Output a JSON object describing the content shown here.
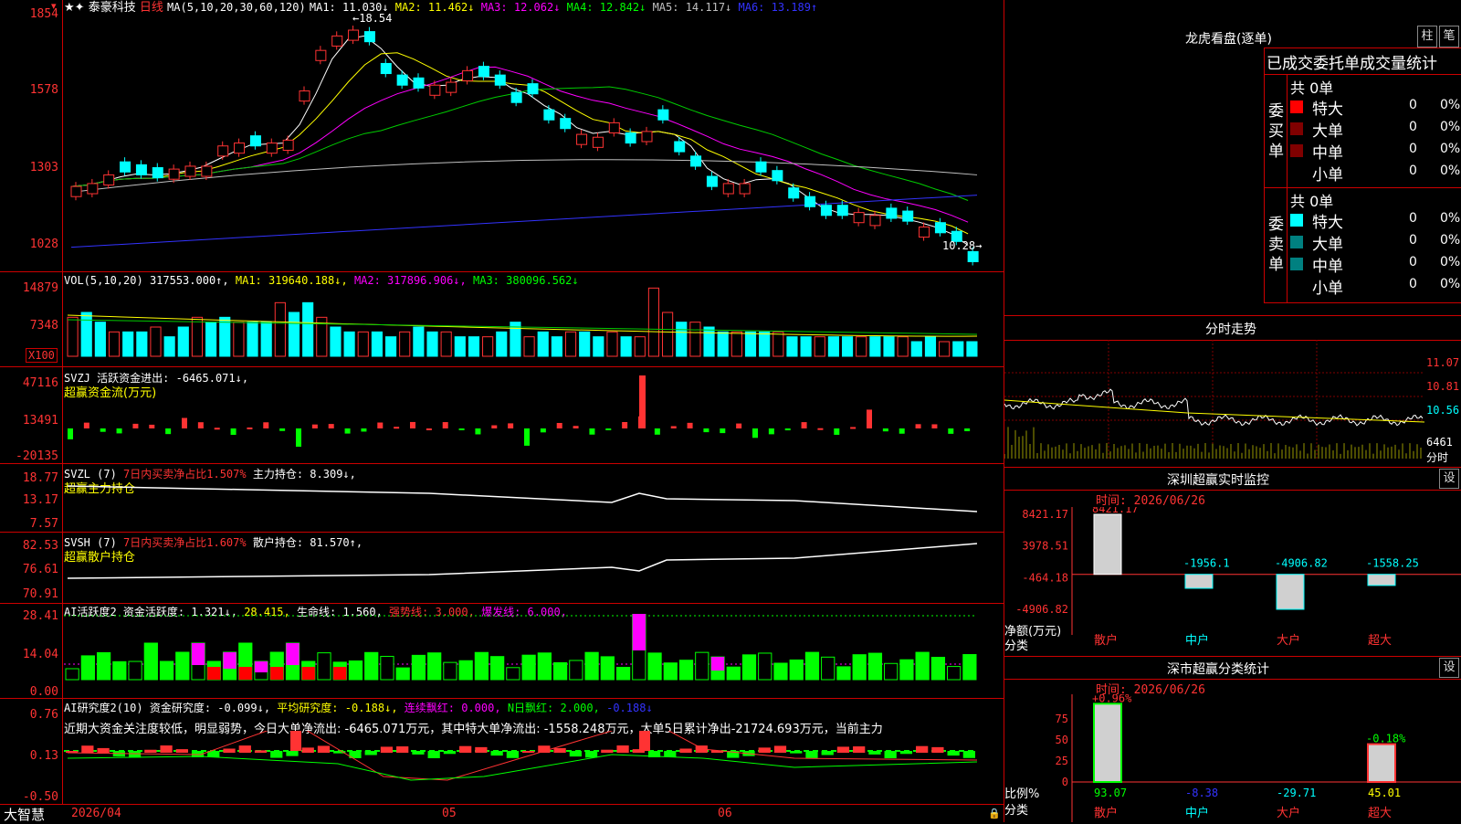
{
  "stock": {
    "name": "泰豪科技",
    "period": "日线",
    "price_high_label": "18.54",
    "price_low_label": "10.28"
  },
  "ma_bar": {
    "title": "MA(5,10,20,30,60,120)",
    "items": [
      {
        "label": "MA1: 11.030↓",
        "color": "#ffffff"
      },
      {
        "label": "MA2: 11.462↓",
        "color": "#ffff00"
      },
      {
        "label": "MA3: 12.062↓",
        "color": "#ff00ff"
      },
      {
        "label": "MA4: 12.842↓",
        "color": "#00ff00"
      },
      {
        "label": "MA5: 14.117↓",
        "color": "#c0c0c0"
      },
      {
        "label": "MA6: 13.189↑",
        "color": "#3333ff"
      }
    ]
  },
  "price_axis": [
    "1854",
    "1578",
    "1303",
    "1028"
  ],
  "vol": {
    "title": "VOL(5,10,20)",
    "value": "317553.000↑,",
    "ma1": "MA1: 319640.188↓,",
    "ma2": "MA2: 317896.906↓,",
    "ma3": "MA3: 380096.562↓",
    "axis": [
      "14879",
      "7348",
      "X100"
    ]
  },
  "svzj": {
    "title": "SVZJ",
    "text": "活跃资金进出: -6465.071↓,",
    "subtitle": "超赢资金流(万元)",
    "axis": [
      "47116",
      "13491",
      "-20135"
    ]
  },
  "svzl": {
    "title": "SVZL (7)",
    "text1": "7日内买卖净占比1.507%",
    "text2": "主力持仓: 8.309↓,",
    "subtitle": "超赢主力持仓",
    "axis": [
      "18.77",
      "13.17",
      "7.57"
    ]
  },
  "svsh": {
    "title": "SVSH (7)",
    "text1": "7日内买卖净占比1.607%",
    "text2": "散户持仓: 81.570↑,",
    "subtitle": "超赢散户持仓",
    "axis": [
      "82.53",
      "76.61",
      "70.91"
    ]
  },
  "ai1": {
    "title": "AI活跃度2",
    "text1": "资金活跃度: 1.321↓,",
    "text2": "28.415,",
    "text3": "生命线: 1.560,",
    "text4": "强势线: 3.000,",
    "text5": "爆发线: 6.000,",
    "axis": [
      "28.41",
      "14.04",
      "0.00"
    ]
  },
  "ai2": {
    "title": "AI研究度2(10)",
    "text1": "资金研究度: -0.099↓,",
    "text2": "平均研究度: -0.188↓,",
    "text3": "连续飘红: 0.000,",
    "text4": "N日飘红: 2.000,",
    "text5": "-0.188↓",
    "comment": "近期大资金关注度较低，明显弱势，今日大单净流出: -6465.071万元，其中特大单净流出: -1558.248万元，大单5日累计净出-21724.693万元，当前主力",
    "axis": [
      "0.76",
      "0.13",
      "-0.50"
    ]
  },
  "x_axis": [
    "2026/04",
    "05",
    "06"
  ],
  "brand": "大智慧",
  "right": {
    "lhb_title": "龙虎看盘(逐单)",
    "tab_zhu": "柱",
    "tab_bi": "笔",
    "stat_title": "已成交委托单成交量统计",
    "buy_label": "委买单",
    "sell_label": "委卖单",
    "buy_total": "共 0单",
    "sell_total": "共 0单",
    "rows": [
      {
        "name": "特大",
        "count": "0",
        "pct": "0%"
      },
      {
        "name": "大单",
        "count": "0",
        "pct": "0%"
      },
      {
        "name": "中单",
        "count": "0",
        "pct": "0%"
      },
      {
        "name": "小单",
        "count": "0",
        "pct": "0%"
      }
    ],
    "fs_title": "分时走势",
    "fs_axis": [
      "11.07",
      "10.81",
      "10.56",
      "6461",
      "分时"
    ],
    "monitor_title": "深圳超赢实时监控",
    "monitor_set": "设",
    "monitor_time": "时间: 2026/06/26",
    "monitor_axis": [
      "8421.17",
      "3978.51",
      "-464.18",
      "-4906.82"
    ],
    "monitor_unit": "净额(万元)",
    "monitor_cat": "分类",
    "monitor_values": [
      {
        "label": "8421.17",
        "value": 8421.17
      },
      {
        "label": "-1956.1",
        "value": -1956.1
      },
      {
        "label": "-4906.82",
        "value": -4906.82
      },
      {
        "label": "-1558.25",
        "value": -1558.25
      }
    ],
    "categories": [
      "散户",
      "中户",
      "大户",
      "超大"
    ],
    "stat2_title": "深市超赢分类统计",
    "stat2_set": "设",
    "stat2_time": "时间: 2026/06/26",
    "stat2_axis": [
      "75",
      "50",
      "25",
      "0"
    ],
    "stat2_unit": "比例%",
    "stat2_cat": "分类",
    "stat2_top": [
      "+0.96%",
      "",
      "",
      "-0.18%"
    ],
    "stat2_values": [
      {
        "label": "93.07",
        "value": 93.07
      },
      {
        "label": "-8.38",
        "value": -8.38
      },
      {
        "label": "-29.71",
        "value": -29.71
      },
      {
        "label": "45.01",
        "value": 45.01
      }
    ]
  },
  "chart_data": [
    {
      "type": "candlestick",
      "ylim": [
        10.0,
        18.9
      ],
      "close": [
        12.9,
        13.0,
        13.3,
        13.4,
        13.3,
        13.2,
        13.5,
        13.6,
        13.6,
        14.3,
        14.4,
        14.3,
        14.4,
        14.5,
        16.2,
        17.6,
        18.1,
        18.3,
        17.9,
        16.8,
        16.4,
        16.3,
        16.4,
        16.5,
        16.9,
        16.7,
        16.4,
        15.8,
        16.1,
        15.2,
        14.9,
        14.7,
        14.6,
        15.1,
        14.4,
        14.8,
        15.2,
        14.1,
        13.6,
        12.9,
        13.0,
        13.0,
        13.4,
        13.1,
        12.5,
        12.2,
        11.9,
        11.9,
        12.0,
        11.9,
        11.8,
        11.7,
        11.5,
        11.3,
        11.0,
        10.3
      ],
      "up": [
        1,
        1,
        1,
        0,
        0,
        0,
        1,
        1,
        1,
        1,
        1,
        0,
        1,
        1,
        1,
        1,
        1,
        1,
        0,
        0,
        0,
        0,
        1,
        1,
        1,
        0,
        0,
        0,
        0,
        0,
        0,
        1,
        1,
        1,
        0,
        1,
        0,
        0,
        0,
        0,
        1,
        1,
        0,
        0,
        0,
        0,
        0,
        0,
        1,
        1,
        0,
        0,
        1,
        0,
        0,
        0
      ]
    },
    {
      "type": "bar",
      "series": "volume",
      "values": [
        8,
        9,
        7,
        5,
        5,
        5,
        6,
        4,
        6,
        8,
        7,
        8,
        7,
        7,
        7,
        11,
        9,
        11,
        8,
        6,
        5,
        5,
        5,
        4,
        5,
        6,
        5,
        5,
        4,
        4,
        4,
        5,
        7,
        4,
        5,
        4,
        5,
        5,
        4,
        5,
        4,
        4,
        14,
        9,
        7,
        7,
        6,
        5,
        5,
        5,
        5,
        5,
        4,
        4,
        4,
        4,
        4,
        4,
        4,
        4,
        4,
        3,
        4,
        3,
        3,
        3
      ]
    }
  ]
}
